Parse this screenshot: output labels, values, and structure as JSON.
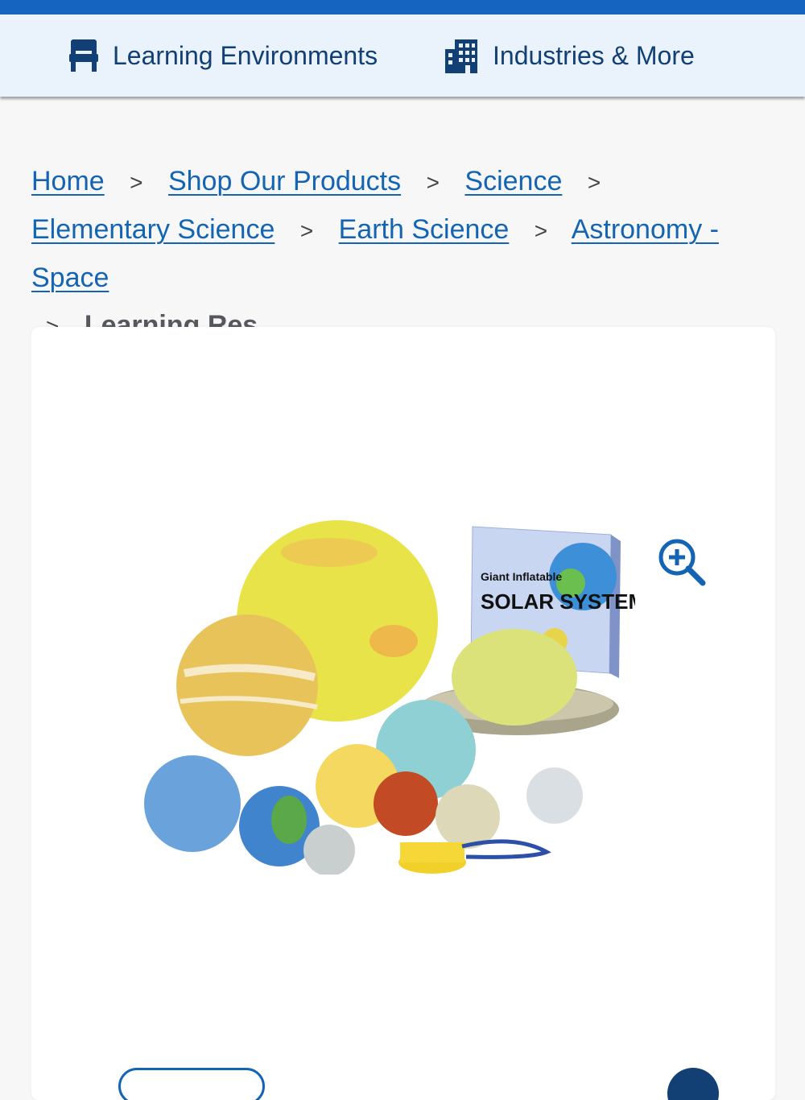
{
  "nav": {
    "learning_label": "Learning Environments",
    "industries_label": "Industries & More"
  },
  "breadcrumb": {
    "items": [
      "Home",
      "Shop Our Products",
      "Science",
      "Elementary Science",
      "Earth Science",
      "Astronomy - Space"
    ],
    "separator": ">",
    "current": "Learning Res..."
  },
  "product": {
    "box_line1": "Giant Inflatable",
    "box_line2": "SOLAR SYSTEM",
    "zoom_icon": "zoom-in-icon"
  },
  "colors": {
    "top_strip": "#1565c0",
    "nav_bg": "#eaf2fb",
    "nav_text": "#123f74",
    "link": "#1464b4",
    "current_crumb": "#55595e"
  }
}
